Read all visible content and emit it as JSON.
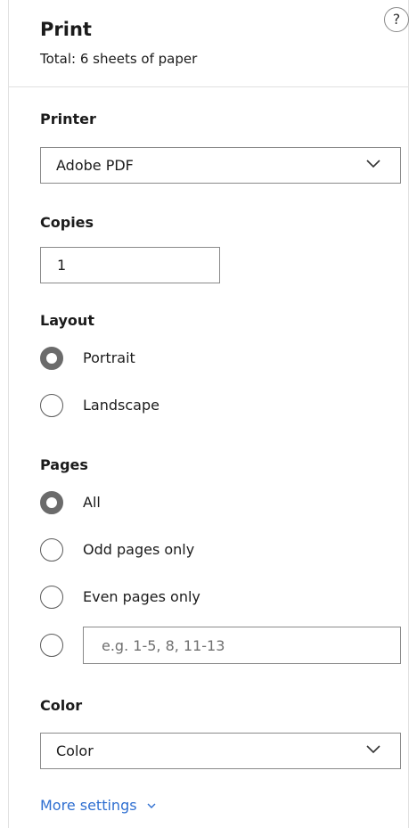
{
  "header": {
    "title": "Print",
    "subtitle": "Total: 6 sheets of paper",
    "help_label": "?"
  },
  "printer": {
    "label": "Printer",
    "selected": "Adobe PDF"
  },
  "copies": {
    "label": "Copies",
    "value": "1"
  },
  "layout": {
    "label": "Layout",
    "options": [
      {
        "label": "Portrait",
        "checked": true
      },
      {
        "label": "Landscape",
        "checked": false
      }
    ]
  },
  "pages": {
    "label": "Pages",
    "options": [
      {
        "label": "All",
        "checked": true
      },
      {
        "label": "Odd pages only",
        "checked": false
      },
      {
        "label": "Even pages only",
        "checked": false
      }
    ],
    "custom_placeholder": "e.g. 1-5, 8, 11-13"
  },
  "color": {
    "label": "Color",
    "selected": "Color"
  },
  "more_settings": {
    "label": "More settings"
  },
  "icons": {
    "help": "help-icon",
    "dropdown": "chevron-down-icon"
  },
  "colors": {
    "accent_link": "#2f6fd1",
    "border": "#8a8a8a",
    "radio_checked": "#6b6b6b"
  }
}
